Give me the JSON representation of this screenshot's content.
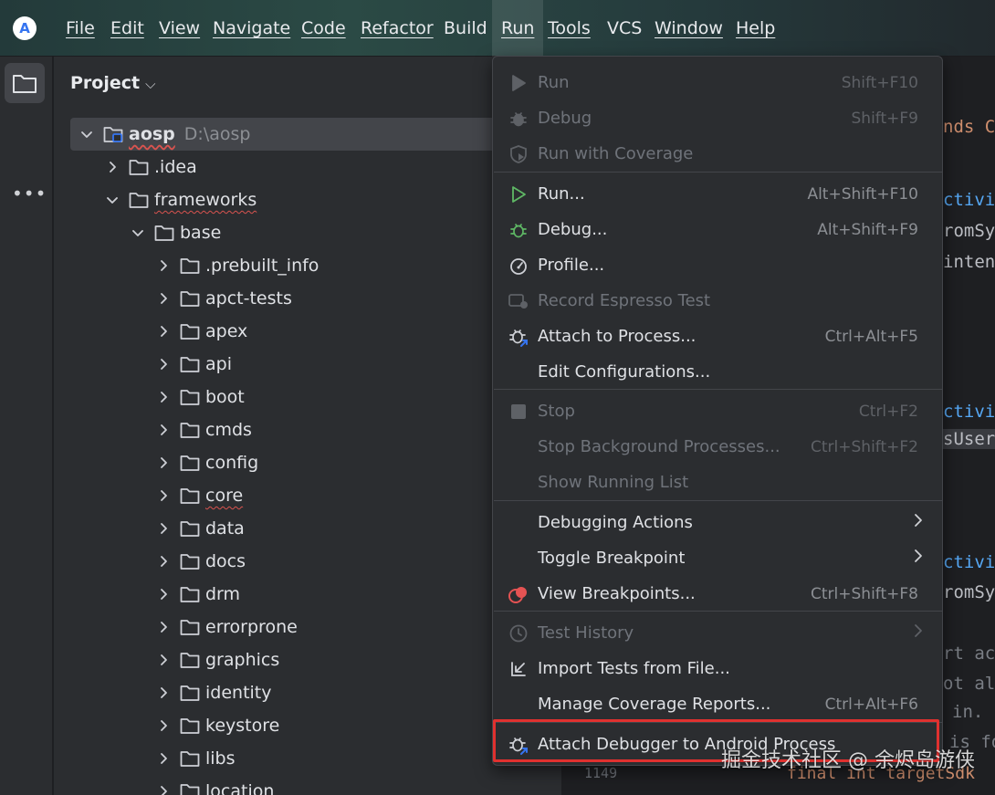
{
  "menubar": {
    "items": [
      "File",
      "Edit",
      "View",
      "Navigate",
      "Code",
      "Refactor",
      "Build",
      "Run",
      "Tools",
      "VCS",
      "Window",
      "Help"
    ],
    "active_item": "Run"
  },
  "project_panel": {
    "title": "Project",
    "root": {
      "name": "aosp",
      "path": "D:\\aosp"
    },
    "items": [
      ".idea",
      "frameworks",
      "base",
      ".prebuilt_info",
      "apct-tests",
      "apex",
      "api",
      "boot",
      "cmds",
      "config",
      "core",
      "data",
      "docs",
      "drm",
      "errorprone",
      "graphics",
      "identity",
      "keystore",
      "libs",
      "location"
    ]
  },
  "run_menu": {
    "items": [
      {
        "label": "Run",
        "shortcut": "Shift+F10",
        "icon": "run-icon",
        "enabled": false
      },
      {
        "label": "Debug",
        "shortcut": "Shift+F9",
        "icon": "debug-bug-icon",
        "enabled": false
      },
      {
        "label": "Run with Coverage",
        "shortcut": "",
        "icon": "coverage-shield-icon",
        "enabled": false
      },
      {
        "label": "Run...",
        "shortcut": "Alt+Shift+F10",
        "icon": "run-icon",
        "enabled": true
      },
      {
        "label": "Debug...",
        "shortcut": "Alt+Shift+F9",
        "icon": "debug-bug-icon",
        "enabled": true
      },
      {
        "label": "Profile...",
        "shortcut": "",
        "icon": "profiler-gauge-icon",
        "enabled": true
      },
      {
        "label": "Record Espresso Test",
        "shortcut": "",
        "icon": "record-icon",
        "enabled": false
      },
      {
        "label": "Attach to Process...",
        "shortcut": "Ctrl+Alt+F5",
        "icon": "attach-bug-icon",
        "enabled": true
      },
      {
        "label": "Edit Configurations...",
        "shortcut": "",
        "icon": "",
        "enabled": true
      },
      {
        "label": "Stop",
        "shortcut": "Ctrl+F2",
        "icon": "stop-icon",
        "enabled": false
      },
      {
        "label": "Stop Background Processes...",
        "shortcut": "Ctrl+Shift+F2",
        "icon": "",
        "enabled": false
      },
      {
        "label": "Show Running List",
        "shortcut": "",
        "icon": "",
        "enabled": false
      },
      {
        "label": "Debugging Actions",
        "shortcut": "",
        "icon": "",
        "enabled": true,
        "submenu": true
      },
      {
        "label": "Toggle Breakpoint",
        "shortcut": "",
        "icon": "",
        "enabled": true,
        "submenu": true
      },
      {
        "label": "View Breakpoints...",
        "shortcut": "Ctrl+Shift+F8",
        "icon": "breakpoints-icon",
        "enabled": true
      },
      {
        "label": "Test History",
        "shortcut": "",
        "icon": "clock-icon",
        "enabled": false,
        "submenu": true
      },
      {
        "label": "Import Tests from File...",
        "shortcut": "",
        "icon": "import-arrow-icon",
        "enabled": true
      },
      {
        "label": "Manage Coverage Reports...",
        "shortcut": "Ctrl+Alt+F6",
        "icon": "",
        "enabled": true
      },
      {
        "label": "Attach Debugger to Android Process",
        "shortcut": "",
        "icon": "attach-bug-icon",
        "enabled": true
      }
    ]
  },
  "editor_fragments": [
    "nds C",
    "ctivi",
    "romSy",
    "inten",
    "ctivi",
    "sUser",
    "ctivi",
    "romSy",
    "rt ac",
    "ot al",
    "in.",
    "is fo",
    "final int targetSdk",
    "1149"
  ],
  "watermark": "掘金技术社区 @ 余烬岛游侠",
  "colors": {
    "accent_blue": "#3574f0",
    "run_green": "#5fb865",
    "breakpoint_red": "#e55353",
    "highlight_red": "#e0312f",
    "code_orange": "#cf8e6d",
    "code_blue": "#56a8f5"
  }
}
